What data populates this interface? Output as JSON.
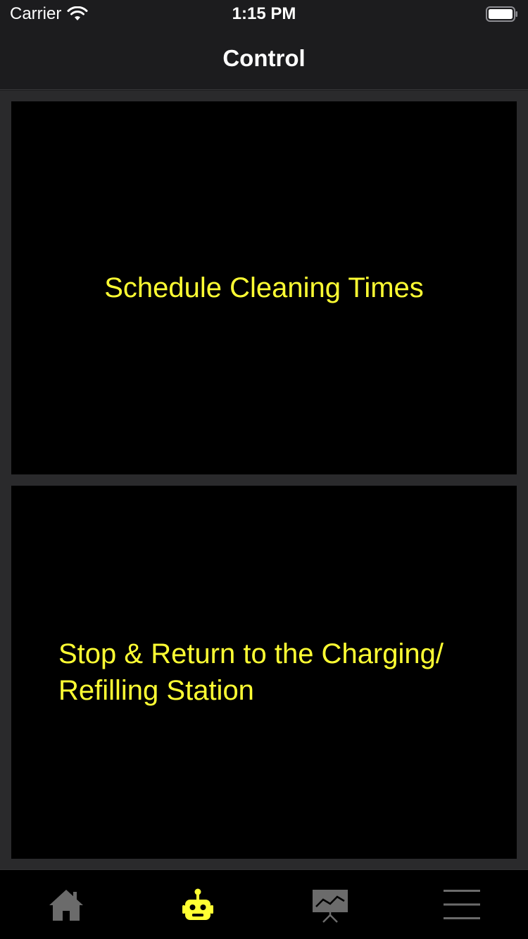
{
  "status_bar": {
    "carrier": "Carrier",
    "time": "1:15 PM",
    "icons": [
      "wifi-icon",
      "battery-icon"
    ]
  },
  "nav": {
    "title": "Control"
  },
  "cards": [
    {
      "label": "Schedule Cleaning Times"
    },
    {
      "label": "Stop & Return to the Charging/\nRefilling Station"
    }
  ],
  "tab_bar": {
    "selected_index": 1,
    "tabs": [
      {
        "icon": "home-icon"
      },
      {
        "icon": "robot-icon"
      },
      {
        "icon": "chart-presentation-icon"
      },
      {
        "icon": "menu-icon"
      }
    ]
  },
  "colors": {
    "accent": "#ffff33",
    "inactive_icon": "#6b6b6b",
    "background": "#1c1c1e",
    "card": "#000000"
  }
}
